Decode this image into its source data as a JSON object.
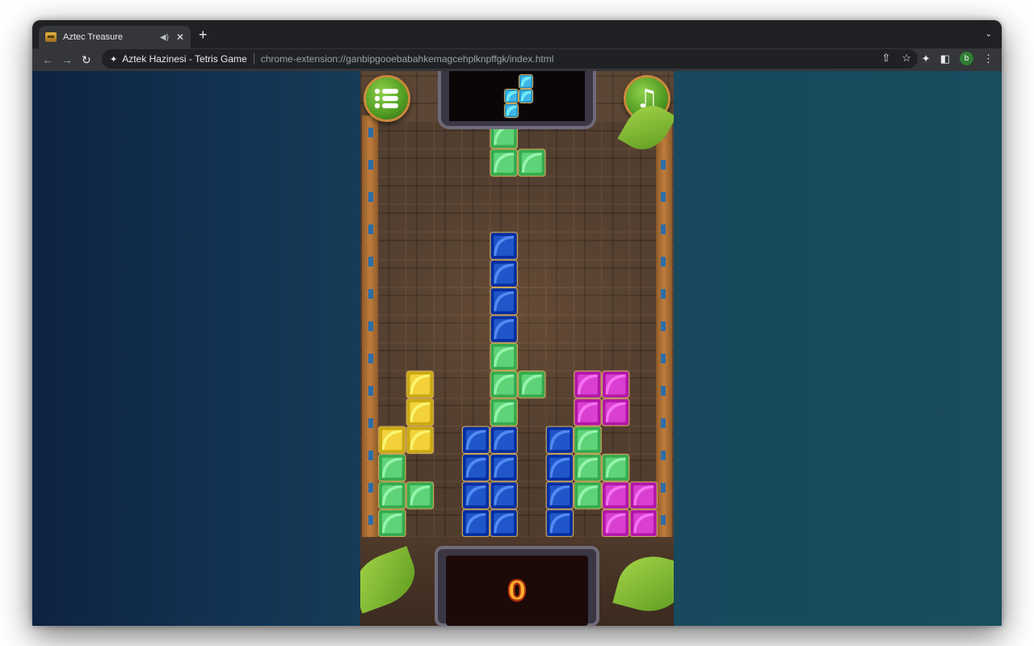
{
  "browser": {
    "tab": {
      "title": "Aztec Treasure",
      "audio_icon": "speaker-icon",
      "close_icon": "close-icon"
    },
    "new_tab_label": "+",
    "address_bar": {
      "site_name": "Aztek Hazinesi - Tetris Game",
      "url": "chrome-extension://ganbipgooebabahkemagcehplknpffgk/index.html"
    },
    "profile_initial": "b"
  },
  "game": {
    "score": "0",
    "board": {
      "columns": 10,
      "rows": 15
    },
    "next_piece": {
      "color": "cyan",
      "cells": [
        [
          1,
          0
        ],
        [
          0,
          1
        ],
        [
          1,
          1
        ],
        [
          0,
          2
        ]
      ]
    },
    "falling_piece": {
      "color": "green",
      "cells": [
        [
          4,
          0
        ],
        [
          4,
          1
        ],
        [
          5,
          1
        ]
      ]
    },
    "grid": [
      "..........",
      "..........",
      "..........",
      "..........",
      "....B.....",
      "....B.....",
      "....B.....",
      "....B.....",
      "....G.....",
      ".Y..GG.MM.",
      ".Y..G..MM.",
      "YY.BB.BG..",
      "G..BB.BGG.",
      "GG.BB.BGMM",
      "G..BB.B.MM"
    ],
    "colors": {
      "B": "#1f56c9",
      "G": "#5fd377",
      "Y": "#f2d13a",
      "M": "#d93fd0",
      "C": "#3fb6ea"
    }
  }
}
